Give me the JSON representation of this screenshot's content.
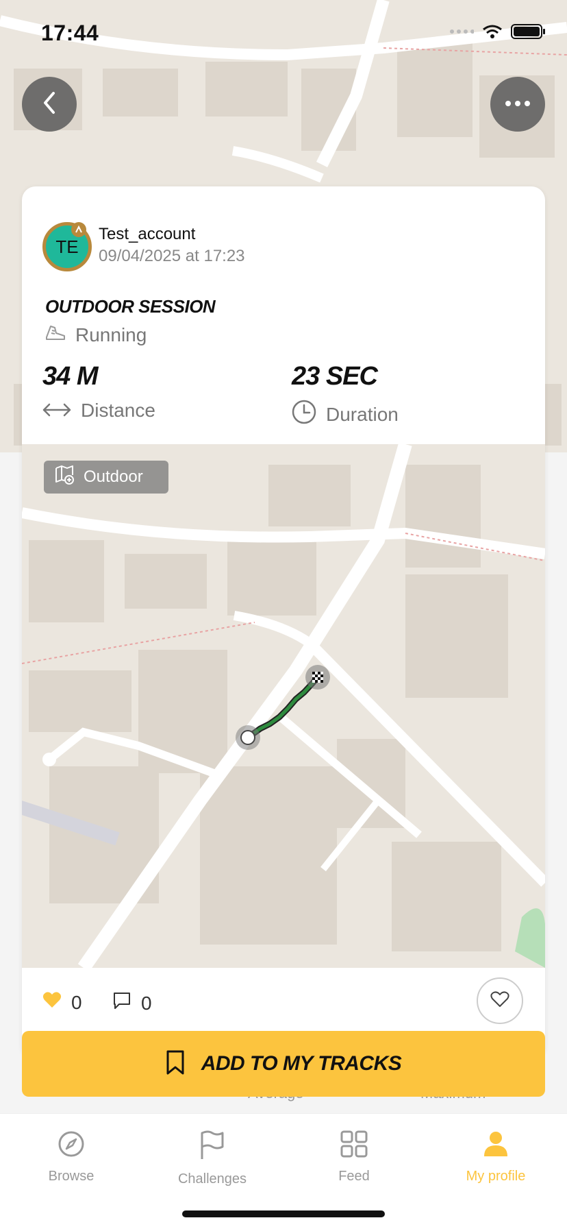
{
  "status_bar": {
    "time": "17:44"
  },
  "header": {
    "back_icon": "chevron-left-icon",
    "more_icon": "ellipsis-icon"
  },
  "post": {
    "avatar_initials": "TE",
    "user_name": "Test_account",
    "date": "09/04/2025 at 17:23",
    "session_title": "OUTDOOR SESSION",
    "sport": "Running",
    "distance_value": "34 M",
    "distance_label": "Distance",
    "duration_value": "23 SEC",
    "duration_label": "Duration",
    "map_tag": "Outdoor"
  },
  "social": {
    "likes": "0",
    "comments": "0"
  },
  "actions": {
    "add_to_tracks": "ADD TO MY TRACKS"
  },
  "peek_labels": {
    "average": "Average",
    "maximum": "Maximum"
  },
  "tabs": [
    {
      "label": "Browse",
      "icon": "compass-icon"
    },
    {
      "label": "Challenges",
      "icon": "flag-icon"
    },
    {
      "label": "Feed",
      "icon": "grid-icon"
    },
    {
      "label": "My profile",
      "icon": "person-icon"
    }
  ],
  "colors": {
    "accent": "#fcc43e",
    "avatar_bg": "#1fb89a",
    "avatar_ring": "#b8893c",
    "route": "#2e8b3e"
  }
}
